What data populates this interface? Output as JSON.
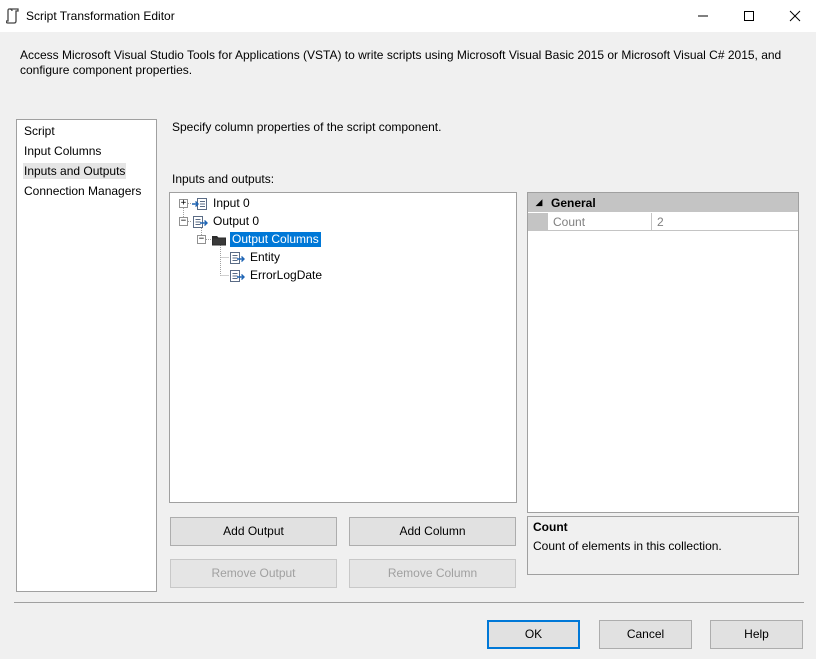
{
  "window": {
    "title": "Script Transformation Editor",
    "icon": "script-icon"
  },
  "description": "Access Microsoft Visual Studio Tools for Applications (VSTA) to write scripts using Microsoft Visual Basic 2015 or Microsoft Visual C# 2015, and configure component properties.",
  "sidebar": {
    "items": [
      {
        "label": "Script"
      },
      {
        "label": "Input Columns"
      },
      {
        "label": "Inputs and Outputs",
        "selected": true
      },
      {
        "label": "Connection Managers"
      }
    ]
  },
  "main": {
    "instruction": "Specify column properties of the script component.",
    "tree_label": "Inputs and outputs:",
    "tree": {
      "input": {
        "label": "Input 0",
        "expanded": false
      },
      "output": {
        "label": "Output 0",
        "expanded": true
      },
      "output_columns": {
        "label": "Output Columns",
        "selected": true,
        "expanded": true
      },
      "columns": [
        {
          "label": "Entity"
        },
        {
          "label": "ErrorLogDate"
        }
      ]
    }
  },
  "properties": {
    "category": "General",
    "rows": [
      {
        "name": "Count",
        "value": "2"
      }
    ]
  },
  "help": {
    "title": "Count",
    "description": "Count of elements in this collection."
  },
  "buttons": {
    "add_output": "Add Output",
    "add_column": "Add Column",
    "remove_output": "Remove Output",
    "remove_column": "Remove Column",
    "ok": "OK",
    "cancel": "Cancel",
    "help": "Help"
  },
  "colors": {
    "selection": "#0078d7",
    "window_bg": "#f0f0f0",
    "category_bg": "#c4c4c4"
  }
}
